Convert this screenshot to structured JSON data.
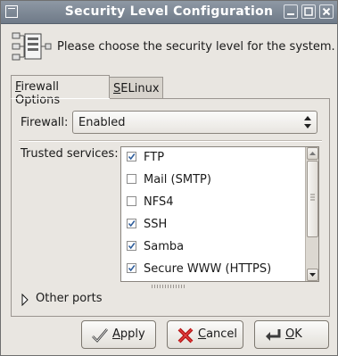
{
  "window": {
    "title": "Security Level Configuration"
  },
  "header": {
    "text": "Please choose the security level for the system."
  },
  "tabs": [
    {
      "mnemonic": "F",
      "rest": "irewall Options",
      "active": true
    },
    {
      "mnemonic": "S",
      "rest": "ELinux",
      "active": false
    }
  ],
  "firewall": {
    "label": "Firewall:",
    "value": "Enabled"
  },
  "trusted_services": {
    "label": "Trusted services:",
    "items": [
      {
        "label": "FTP",
        "checked": true
      },
      {
        "label": "Mail (SMTP)",
        "checked": false
      },
      {
        "label": "NFS4",
        "checked": false
      },
      {
        "label": "SSH",
        "checked": true
      },
      {
        "label": "Samba",
        "checked": true
      },
      {
        "label": "Secure WWW (HTTPS)",
        "checked": true
      }
    ]
  },
  "other_ports": {
    "label": "Other ports"
  },
  "buttons": {
    "apply": {
      "mnemonic": "A",
      "rest": "pply"
    },
    "cancel": {
      "mnemonic": "C",
      "rest": "ancel"
    },
    "ok": {
      "mnemonic": "O",
      "rest": "K"
    }
  },
  "colors": {
    "titlebar": "#7a8593",
    "window_bg": "#e9e6e1",
    "check": "#2f5e9c"
  }
}
